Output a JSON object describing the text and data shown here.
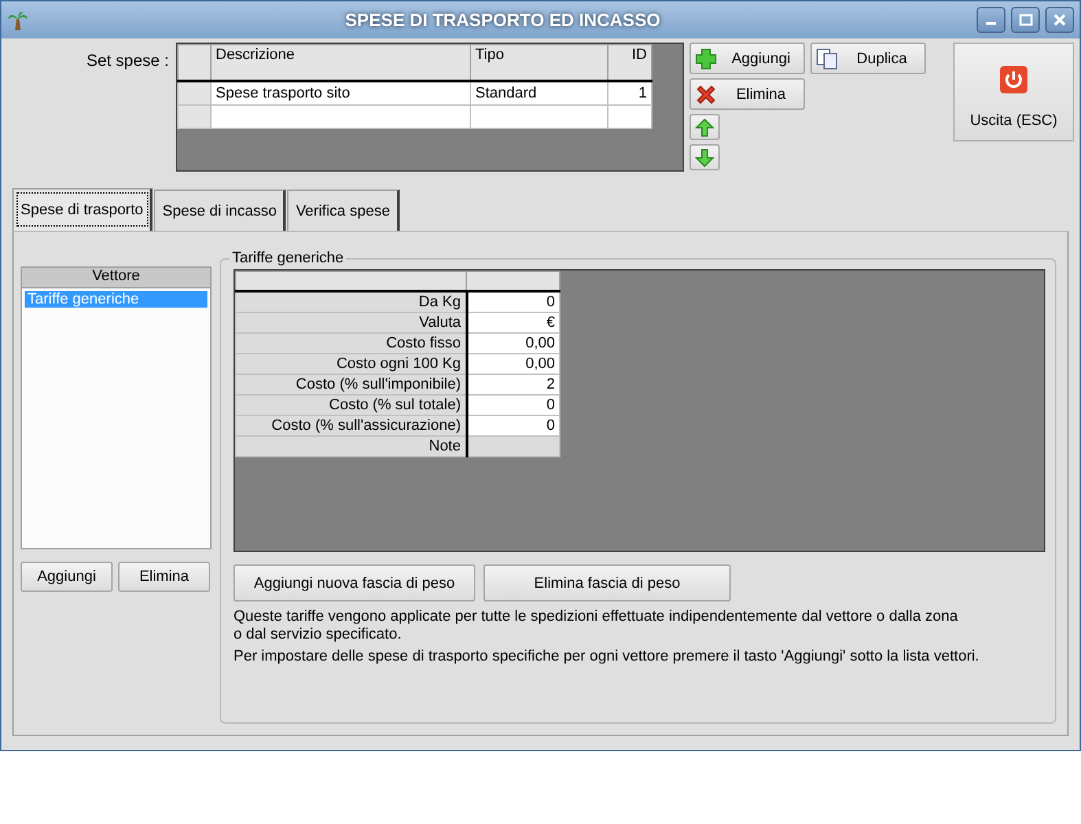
{
  "window": {
    "title": "SPESE DI TRASPORTO ED INCASSO"
  },
  "set_spese": {
    "label": "Set spese :",
    "columns": [
      "Descrizione",
      "Tipo",
      "ID"
    ],
    "rows": [
      {
        "descrizione": "Spese trasporto sito",
        "tipo": "Standard",
        "id": "1"
      }
    ]
  },
  "side_buttons": [
    {
      "kind": "add",
      "label": "Aggiungi"
    },
    {
      "kind": "delete",
      "label": "Elimina"
    },
    {
      "kind": "up"
    },
    {
      "kind": "down"
    }
  ],
  "duplicate_button": "Duplica",
  "exit_button": "Uscita (ESC)",
  "tabs": [
    {
      "label": "Spese di trasporto",
      "selected": true
    },
    {
      "label": "Spese di incasso",
      "selected": false
    },
    {
      "label": "Verifica spese",
      "selected": false
    }
  ],
  "vettore": {
    "header": "Vettore",
    "items": [
      {
        "label": "Tariffe generiche",
        "selected": true
      }
    ],
    "buttons": [
      "Aggiungi",
      "Elimina"
    ]
  },
  "tariffe": {
    "title": "Tariffe generiche",
    "rows": [
      {
        "label": "Da Kg",
        "value": "0"
      },
      {
        "label": "Valuta",
        "value": "€"
      },
      {
        "label": "Costo fisso",
        "value": "0,00"
      },
      {
        "label": "Costo ogni 100 Kg",
        "value": "0,00"
      },
      {
        "label": "Costo (% sull'imponibile)",
        "value": "2"
      },
      {
        "label": "Costo (% sul totale)",
        "value": "0"
      },
      {
        "label": "Costo (% sull'assicurazione)",
        "value": "0"
      },
      {
        "label": "Note",
        "value": "",
        "kind": "note"
      }
    ],
    "buttons": [
      "Aggiungi nuova fascia di peso",
      "Elimina fascia di peso"
    ],
    "info_lines": [
      "Queste tariffe vengono applicate per tutte le spedizioni effettuate indipendentemente dal vettore o dalla zona",
      "o dal servizio specificato.",
      "Per impostare delle spese di trasporto specifiche per ogni vettore premere il tasto 'Aggiungi' sotto la lista vettori."
    ]
  }
}
